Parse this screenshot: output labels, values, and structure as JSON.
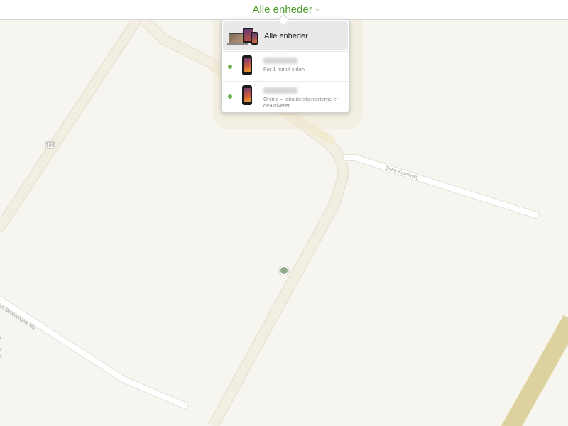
{
  "header": {
    "selector_label": "Alle enheder",
    "chevron_icon": "chevron-down-icon",
    "accent_color": "#4a9a2a"
  },
  "device_menu": {
    "all_devices_label": "Alle enheder",
    "devices": [
      {
        "name": "",
        "status": "For 1 minut siden",
        "online": true,
        "icon": "iphone-icon"
      },
      {
        "name": "",
        "status": "Online – lokalitetstjenesterne er deaktiveret",
        "online": true,
        "icon": "iphone-icon"
      }
    ]
  },
  "map": {
    "road_labels": {
      "route": "180",
      "east_road": "Østre Fannevej",
      "west_road": "stian Severinsens Vej"
    },
    "edge_fragments": [
      "k",
      "s",
      "e"
    ],
    "location_dot_color": "#8fa88a"
  }
}
